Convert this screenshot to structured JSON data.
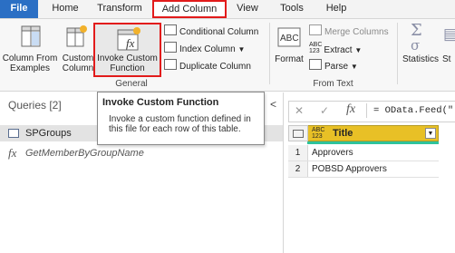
{
  "tabs": [
    {
      "label": "File"
    },
    {
      "label": "Home"
    },
    {
      "label": "Transform"
    },
    {
      "label": "Add Column"
    },
    {
      "label": "View"
    },
    {
      "label": "Tools"
    },
    {
      "label": "Help"
    }
  ],
  "ribbon": {
    "column_from_examples": "Column From\nExamples",
    "custom_column": "Custom\nColumn",
    "invoke_custom_function": "Invoke Custom\nFunction",
    "conditional_column": "Conditional Column",
    "index_column": "Index Column",
    "duplicate_column": "Duplicate Column",
    "general_group": "General",
    "format": "Format",
    "merge_columns": "Merge Columns",
    "extract": "Extract",
    "parse": "Parse",
    "from_text_group": "From Text",
    "statistics": "Statistics",
    "standard_partial": "St"
  },
  "tooltip": {
    "title": "Invoke Custom Function",
    "body": "Invoke a custom function defined in this file for each row of this table."
  },
  "queries": {
    "title": "Queries [2]",
    "items": [
      {
        "label": "SPGroups",
        "icon": "table-icon"
      },
      {
        "label": "GetMemberByGroupName",
        "icon": "function-icon"
      }
    ]
  },
  "formula_bar": {
    "cancel": "✕",
    "accept": "✓",
    "fx": "fx",
    "value": "= OData.Feed(\""
  },
  "grid": {
    "type_badge_top": "ABC",
    "type_badge_bottom": "123",
    "column_header": "Title",
    "rows": [
      {
        "num": "1",
        "title": "Approvers"
      },
      {
        "num": "2",
        "title": "POBSD Approvers"
      }
    ]
  },
  "colors": {
    "file_tab": "#2b6fc4",
    "highlight": "#e21b1b",
    "column_header": "#e8c026"
  }
}
